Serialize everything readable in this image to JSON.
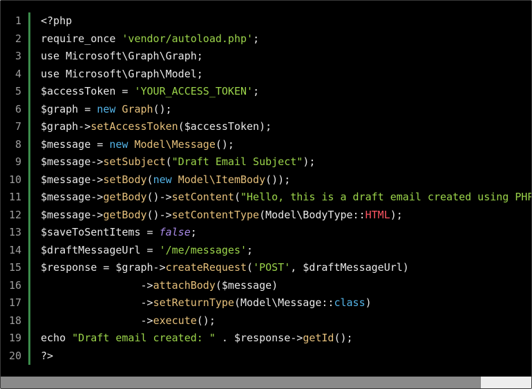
{
  "line_numbers": [
    "1",
    "2",
    "3",
    "4",
    "5",
    "6",
    "7",
    "8",
    "9",
    "10",
    "11",
    "12",
    "13",
    "14",
    "15",
    "16",
    "17",
    "18",
    "19",
    "20"
  ],
  "lines": [
    [
      [
        "default",
        "<?php"
      ]
    ],
    [
      [
        "default",
        "require_once "
      ],
      [
        "string",
        "'vendor/autoload.php'"
      ],
      [
        "default",
        ";"
      ]
    ],
    [
      [
        "default",
        "use Microsoft\\Graph\\Graph;"
      ]
    ],
    [
      [
        "default",
        "use Microsoft\\Graph\\Model;"
      ]
    ],
    [
      [
        "default",
        "$accessToken = "
      ],
      [
        "string",
        "'YOUR_ACCESS_TOKEN'"
      ],
      [
        "default",
        ";"
      ]
    ],
    [
      [
        "default",
        "$graph = "
      ],
      [
        "keyword",
        "new "
      ],
      [
        "func",
        "Graph"
      ],
      [
        "default",
        "();"
      ]
    ],
    [
      [
        "default",
        "$graph->"
      ],
      [
        "func",
        "setAccessToken"
      ],
      [
        "default",
        "($accessToken);"
      ]
    ],
    [
      [
        "default",
        "$message = "
      ],
      [
        "keyword",
        "new "
      ],
      [
        "func",
        "Model\\Message"
      ],
      [
        "default",
        "();"
      ]
    ],
    [
      [
        "default",
        "$message->"
      ],
      [
        "func",
        "setSubject"
      ],
      [
        "default",
        "("
      ],
      [
        "string",
        "\"Draft Email Subject\""
      ],
      [
        "default",
        ");"
      ]
    ],
    [
      [
        "default",
        "$message->"
      ],
      [
        "func",
        "setBody"
      ],
      [
        "default",
        "("
      ],
      [
        "keyword",
        "new "
      ],
      [
        "func",
        "Model\\ItemBody"
      ],
      [
        "default",
        "());"
      ]
    ],
    [
      [
        "default",
        "$message->"
      ],
      [
        "func",
        "getBody"
      ],
      [
        "default",
        "()->"
      ],
      [
        "func",
        "setContent"
      ],
      [
        "default",
        "("
      ],
      [
        "string",
        "\"Hello, this is a draft email created using PHP.\""
      ],
      [
        "default",
        ");"
      ]
    ],
    [
      [
        "default",
        "$message->"
      ],
      [
        "func",
        "getBody"
      ],
      [
        "default",
        "()->"
      ],
      [
        "func",
        "setContentType"
      ],
      [
        "default",
        "(Model\\BodyType::"
      ],
      [
        "const",
        "HTML"
      ],
      [
        "default",
        ");"
      ]
    ],
    [
      [
        "default",
        "$saveToSentItems = "
      ],
      [
        "keyword-italic",
        "false"
      ],
      [
        "default",
        ";"
      ]
    ],
    [
      [
        "default",
        "$draftMessageUrl = "
      ],
      [
        "string",
        "'/me/messages'"
      ],
      [
        "default",
        ";"
      ]
    ],
    [
      [
        "default",
        "$response = $graph->"
      ],
      [
        "func",
        "createRequest"
      ],
      [
        "default",
        "("
      ],
      [
        "string",
        "'POST'"
      ],
      [
        "default",
        ", $draftMessageUrl)"
      ]
    ],
    [
      [
        "default",
        "                ->"
      ],
      [
        "func",
        "attachBody"
      ],
      [
        "default",
        "($message)"
      ]
    ],
    [
      [
        "default",
        "                ->"
      ],
      [
        "func",
        "setReturnType"
      ],
      [
        "default",
        "(Model\\Message::"
      ],
      [
        "keyword",
        "class"
      ],
      [
        "default",
        ")"
      ]
    ],
    [
      [
        "default",
        "                ->"
      ],
      [
        "func",
        "execute"
      ],
      [
        "default",
        "();"
      ]
    ],
    [
      [
        "default",
        "echo "
      ],
      [
        "string",
        "\"Draft email created: \""
      ],
      [
        "default",
        " . $response->"
      ],
      [
        "func",
        "getId"
      ],
      [
        "default",
        "();"
      ]
    ],
    [
      [
        "default",
        "?>"
      ]
    ]
  ],
  "colors": {
    "background": "#000000",
    "gutter_bar": "#3c8c4c",
    "line_number": "#9e9e9e"
  }
}
